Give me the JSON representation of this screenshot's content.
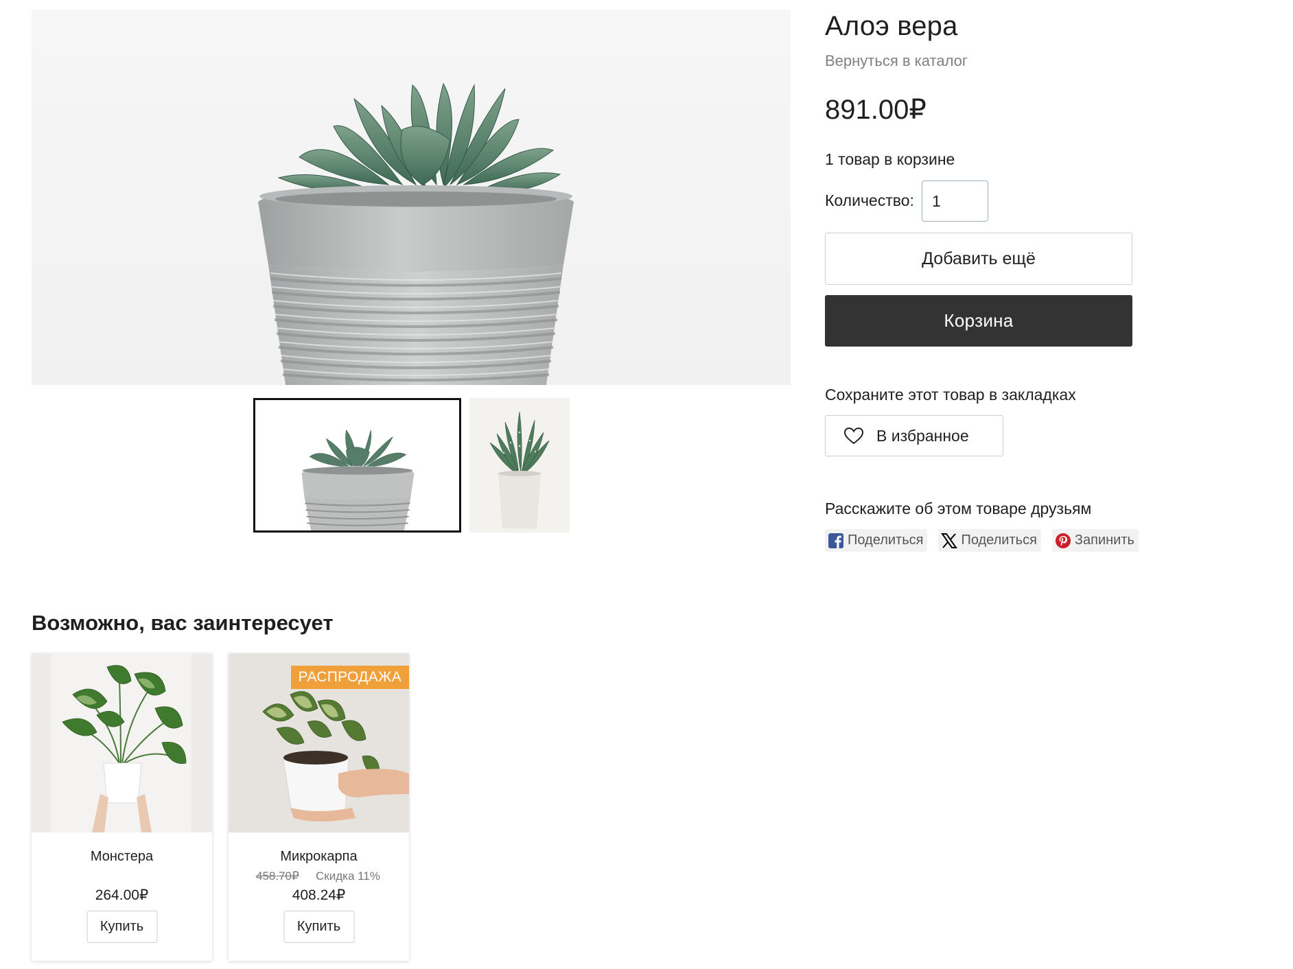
{
  "product": {
    "title": "Алоэ вера",
    "back_link": "Вернуться в каталог",
    "price": "891.00₽",
    "in_cart_text": "1 товар в корзине",
    "quantity_label": "Количество:",
    "quantity_value": "1",
    "add_more_label": "Добавить ещё",
    "cart_label": "Корзина"
  },
  "gallery": {
    "thumbnails": [
      {
        "name": "succulent-concrete-pot",
        "selected": true
      },
      {
        "name": "aloe-white-pot",
        "selected": false
      }
    ]
  },
  "bookmark": {
    "title": "Сохраните этот товар в закладках",
    "favorite_label": "В избранное",
    "icon": "heart-icon"
  },
  "share": {
    "title": "Расскажите об этом товаре друзьям",
    "buttons": [
      {
        "label": "Поделиться",
        "icon": "facebook-icon",
        "color": "#3b5998"
      },
      {
        "label": "Поделиться",
        "icon": "x-icon",
        "color": "#000000"
      },
      {
        "label": "Запинить",
        "icon": "pinterest-icon",
        "color": "#cb2027"
      }
    ]
  },
  "recommendations": {
    "title": "Возможно, вас заинтересует",
    "items": [
      {
        "name": "Монстера",
        "price": "264.00₽",
        "buy_label": "Купить"
      },
      {
        "name": "Микрокарпа",
        "badge": "РАСПРОДАЖА",
        "old_price": "458.70₽",
        "discount": "Скидка 11%",
        "price": "408.24₽",
        "buy_label": "Купить"
      }
    ]
  },
  "colors": {
    "accent_dark": "#333333",
    "sale_badge": "#f0a03a",
    "input_border": "#9ab2c6"
  }
}
